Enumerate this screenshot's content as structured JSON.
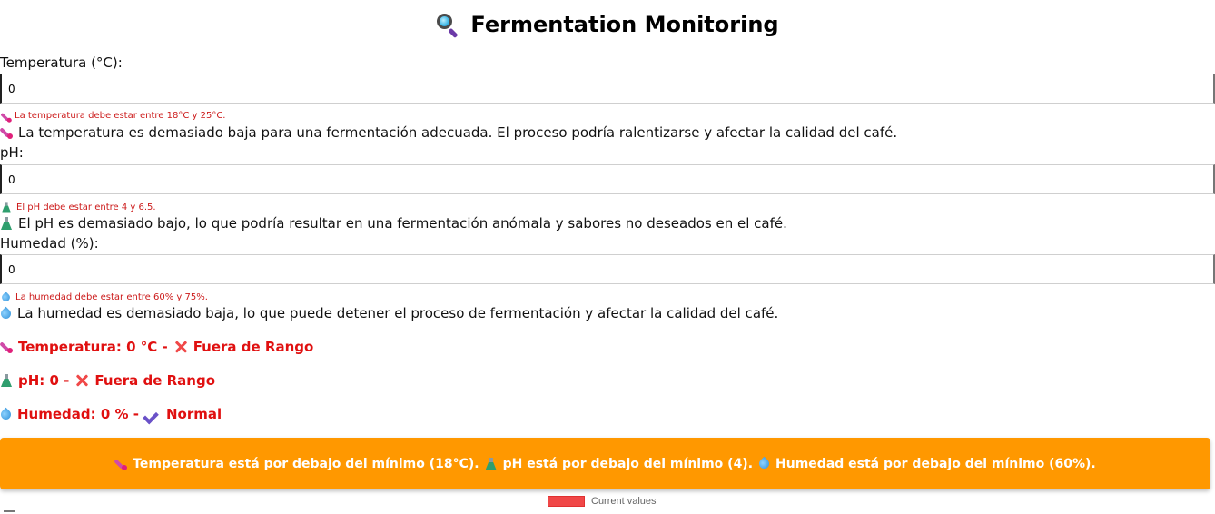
{
  "header": {
    "title": "Fermentation Monitoring",
    "icon": "magnifying-glass-icon"
  },
  "form": {
    "temperature": {
      "label": "Temperatura (°C):",
      "value": "0",
      "hint": "La temperatura debe estar entre 18°C y 25°C.",
      "message": "La temperatura es demasiado baja para una fermentación adecuada. El proceso podría ralentizarse y afectar la calidad del café.",
      "icon": "thermometer-icon"
    },
    "ph": {
      "label": "pH:",
      "value": "0",
      "hint": "El pH debe estar entre 4 y 6.5.",
      "message": "El pH es demasiado bajo, lo que podría resultar en una fermentación anómala y sabores no deseados en el café.",
      "icon": "flask-icon"
    },
    "humidity": {
      "label": "Humedad (%):",
      "value": "0",
      "hint": "La humedad debe estar entre 60% y 75%.",
      "message": "La humedad es demasiado baja, lo que puede detener el proceso de fermentación y afectar la calidad del café.",
      "icon": "droplet-icon"
    }
  },
  "status": {
    "temperature": {
      "text": "Temperatura: 0 °C -",
      "state": "Fuera de Rango",
      "state_icon": "cross-mark-icon"
    },
    "ph": {
      "text": "pH: 0 -",
      "state": "Fuera de Rango",
      "state_icon": "cross-mark-icon"
    },
    "humidity": {
      "text": "Humedad: 0 % -",
      "state": "Normal",
      "state_icon": "check-mark-icon"
    },
    "color": "#e01010"
  },
  "alert": {
    "temperature": "Temperatura está por debajo del mínimo (18°C).",
    "ph": "pH está por debajo del mínimo (4).",
    "humidity": "Humedad está por debajo del mínimo (60%).",
    "background": "#ff9800"
  },
  "chart_legend": {
    "label": "Current values",
    "color": "#f04747"
  }
}
